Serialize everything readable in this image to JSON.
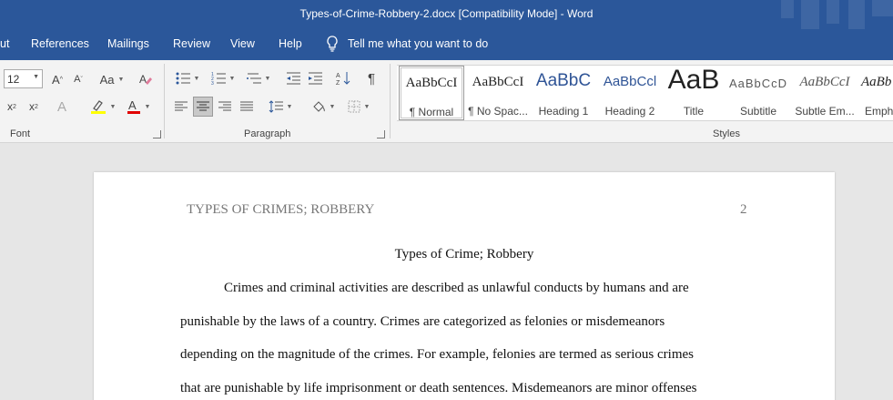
{
  "window": {
    "title": "Types-of-Crime-Robbery-2.docx [Compatibility Mode]  -  Word"
  },
  "menu": {
    "tabs": [
      "ut",
      "References",
      "Mailings",
      "Review",
      "View",
      "Help"
    ],
    "tell_me": "Tell me what you want to do"
  },
  "ribbon": {
    "font_size": "12",
    "change_case": "Aa",
    "groups": {
      "font": "Font",
      "paragraph": "Paragraph",
      "styles": "Styles"
    }
  },
  "styles": [
    {
      "preview": "AaBbCcI",
      "name": "¶ Normal"
    },
    {
      "preview": "AaBbCcI",
      "name": "¶ No Spac..."
    },
    {
      "preview": "AaBbC",
      "name": "Heading 1"
    },
    {
      "preview": "AaBbCcl",
      "name": "Heading 2"
    },
    {
      "preview": "AaB",
      "name": "Title"
    },
    {
      "preview": "AaBbCcD",
      "name": "Subtitle"
    },
    {
      "preview": "AaBbCcI",
      "name": "Subtle Em..."
    },
    {
      "preview": "AaBb",
      "name": "Emph"
    }
  ],
  "document": {
    "running_head": "TYPES OF CRIMES; ROBBERY",
    "page_number": "2",
    "title": "Types of Crime; Robbery",
    "lines": [
      "Crimes and criminal activities are described as unlawful conducts by humans and are",
      "punishable by the laws of a country. Crimes are categorized as felonies or misdemeanors",
      "depending on the magnitude of the crimes. For example, felonies are termed as serious crimes",
      "that are punishable by life imprisonment or death sentences. Misdemeanors are minor offenses"
    ]
  },
  "colors": {
    "accent": "#2b579a",
    "ribbon": "#f3f3f3",
    "canvas": "#e6e6e6",
    "heading_blue": "#2f5496"
  }
}
